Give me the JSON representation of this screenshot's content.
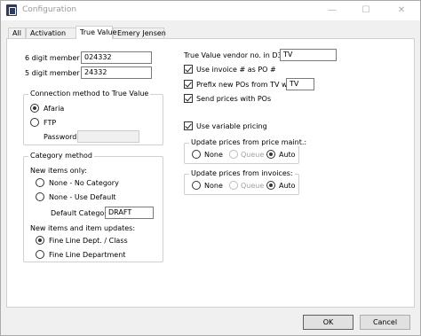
{
  "window": {
    "title": "Configuration"
  },
  "tabs": [
    "All",
    "Activation",
    "True Value",
    "Emery Jensen"
  ],
  "member": {
    "six_label": "6 digit member ID:",
    "six_value": "024332",
    "five_label": "5 digit member ID:",
    "five_value": "24332"
  },
  "connection": {
    "title": "Connection method to True Value",
    "options": [
      "Afaria",
      "FTP"
    ],
    "selected": "Afaria",
    "password_label": "Password:",
    "password_value": ""
  },
  "category": {
    "title": "Category method",
    "new_items_label": "New items only:",
    "new_items_options": [
      "None - No Category",
      "None - Use Default"
    ],
    "default_category_label": "Default Category:",
    "default_category_value": "DRAFT",
    "updates_label": "New items and item updates:",
    "updates_options": [
      "Fine Line Dept. / Class",
      "Fine Line Department"
    ],
    "updates_selected": "Fine Line Dept. / Class"
  },
  "vendor": {
    "label": "True Value vendor no. in D365:",
    "value": "TV"
  },
  "options": {
    "invoice_label": "Use invoice # as PO #",
    "invoice_checked": true,
    "prefix_label": "Prefix new POs from TV with:",
    "prefix_checked": true,
    "prefix_value": "TV",
    "send_label": "Send prices with POs",
    "send_checked": true,
    "variable_label": "Use variable pricing",
    "variable_checked": true
  },
  "price_maint": {
    "title": "Update prices from price maint.:",
    "options": [
      "None",
      "Queue",
      "Auto"
    ],
    "selected": "Auto"
  },
  "price_invoices": {
    "title": "Update prices from invoices:",
    "options": [
      "None",
      "Queue",
      "Auto"
    ],
    "selected": "Auto"
  },
  "buttons": {
    "ok": "OK",
    "cancel": "Cancel"
  }
}
